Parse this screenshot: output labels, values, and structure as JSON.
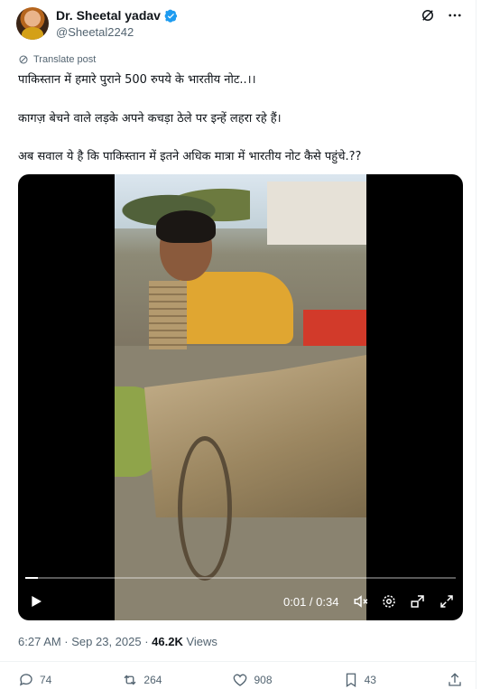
{
  "author": {
    "name": "Dr. Sheetal yadav",
    "handle": "@Sheetal2242",
    "verified": true
  },
  "translate_label": "Translate post",
  "post_lines": [
    "पाकिस्तान में हमारे पुराने 500 रुपये के भारतीय नोट..।।",
    "कागज़ बेचने वाले लड़के अपने कचड़ा ठेले पर इन्हें लहरा रहे हैं।",
    "अब सवाल ये है कि पाकिस्तान में इतने अधिक मात्रा में भारतीय नोट कैसे पहुंचे.??"
  ],
  "video": {
    "time_display": "0:01 / 0:34",
    "progress_fraction": 0.03
  },
  "meta": {
    "timestamp": "6:27 AM · Sep 23, 2025 · ",
    "views": "46.2K",
    "views_label": " Views"
  },
  "actions": {
    "replies": "74",
    "reposts": "264",
    "likes": "908",
    "bookmarks": "43"
  },
  "icons": [
    "verified-badge-icon",
    "grok-icon",
    "more-icon",
    "translate-icon",
    "play-icon",
    "volume-icon",
    "settings-icon",
    "minimize-icon",
    "fullscreen-icon",
    "reply-icon",
    "repost-icon",
    "like-icon",
    "bookmark-icon",
    "share-icon"
  ],
  "colors": {
    "verified": "#1d9bf0",
    "muted": "#536471",
    "text": "#0f1419"
  }
}
